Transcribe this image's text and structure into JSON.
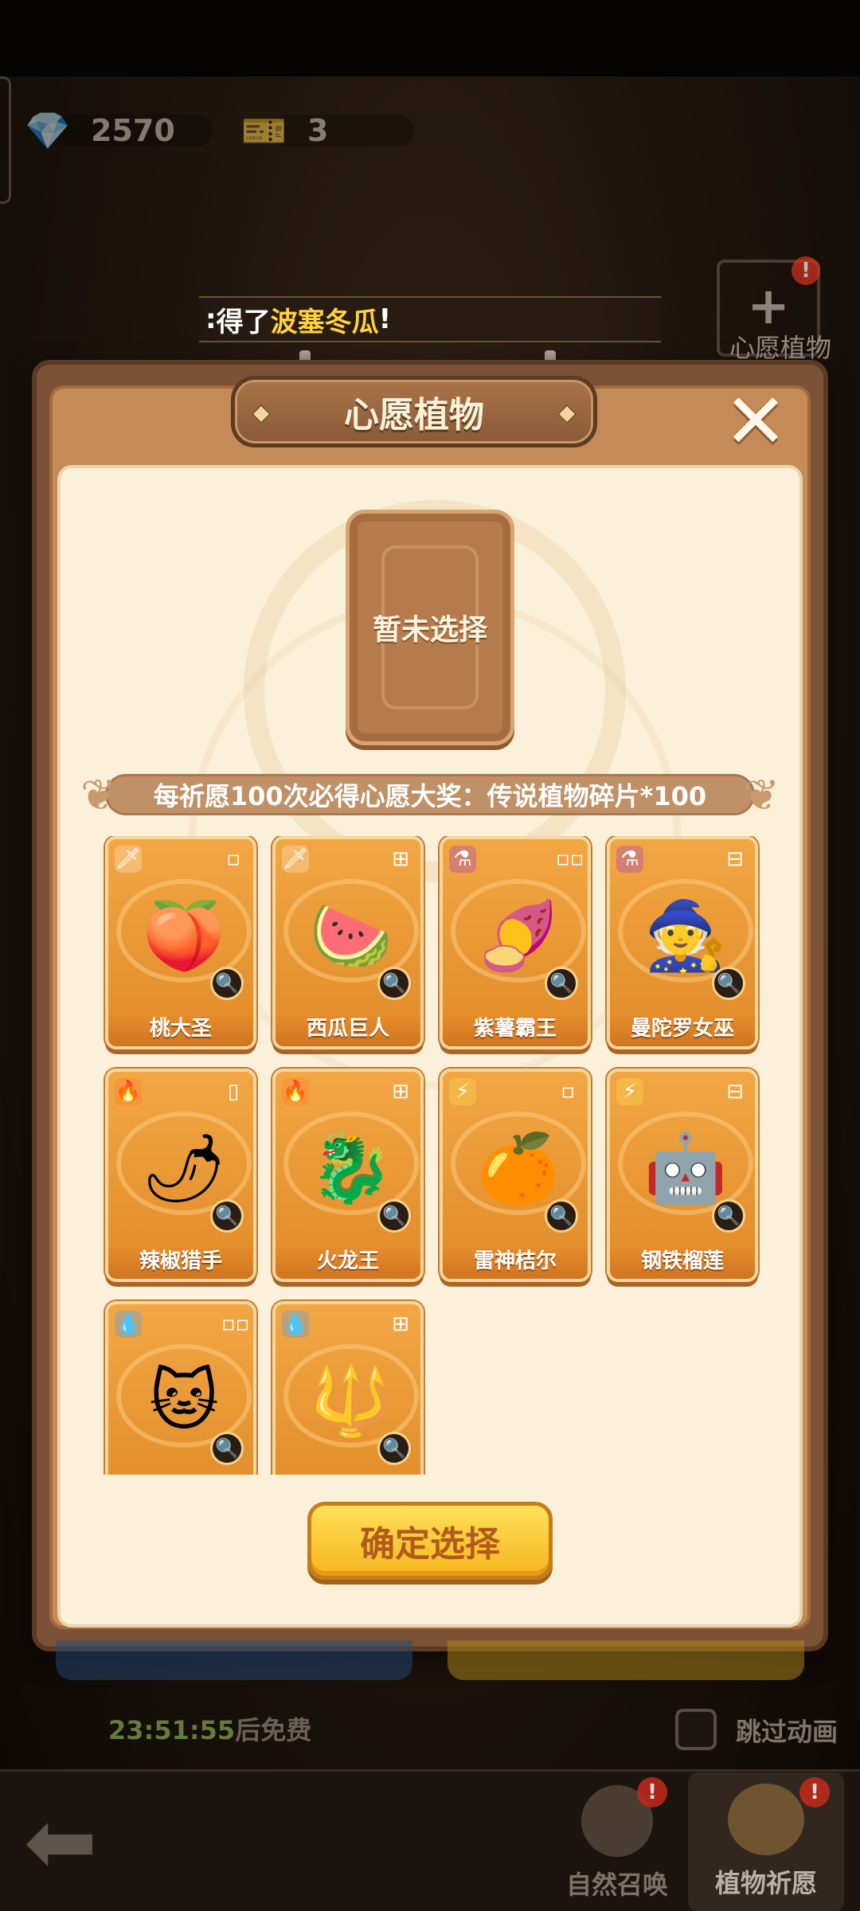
{
  "resources": {
    "gems": "2570",
    "tickets": "3",
    "gem_icon": "gem-icon",
    "ticket_icon": "ticket-icon"
  },
  "corner_button": {
    "label": "心愿植物",
    "badge": "!"
  },
  "notice": {
    "prefix": "得了",
    "highlight": "波塞冬瓜",
    "suffix": "!"
  },
  "modal": {
    "title": "心愿植物",
    "slot_text": "暂未选择",
    "banner": "每祈愿100次必得心愿大奖：传说植物碎片*100",
    "confirm_label": "确定选择"
  },
  "cards": [
    {
      "name": "桃大圣",
      "element": "blade-icon",
      "face": "🍑",
      "size": "▫"
    },
    {
      "name": "西瓜巨人",
      "element": "blade-icon",
      "face": "🍉",
      "size": "⊞"
    },
    {
      "name": "紫薯霸王",
      "element": "potion-icon",
      "face": "🍠",
      "size": "▫▫"
    },
    {
      "name": "曼陀罗女巫",
      "element": "potion-icon",
      "face": "🧙",
      "size": "⊟"
    },
    {
      "name": "辣椒猎手",
      "element": "fire-icon",
      "face": "🌶",
      "size": "▯"
    },
    {
      "name": "火龙王",
      "element": "fire-icon",
      "face": "🐉",
      "size": "⊞"
    },
    {
      "name": "雷神桔尔",
      "element": "bolt-icon",
      "face": "🍊",
      "size": "▫"
    },
    {
      "name": "钢铁榴莲",
      "element": "bolt-icon",
      "face": "🤖",
      "size": "⊟"
    },
    {
      "name": "",
      "element": "water-icon",
      "face": "🐱",
      "size": "▫▫"
    },
    {
      "name": "",
      "element": "water-icon",
      "face": "🔱",
      "size": "⊞"
    }
  ],
  "footer": {
    "timer_value": "23:51:55",
    "timer_suffix": "后免费",
    "skip_label": "跳过动画",
    "tabs": [
      {
        "label": "自然召唤",
        "badge": "!"
      },
      {
        "label": "植物祈愿",
        "badge": "!"
      }
    ]
  },
  "colors": {
    "accent": "#f6b51e",
    "panel": "#fbf1db",
    "frame": "#7b5236",
    "highlight": "#ffd23a"
  }
}
